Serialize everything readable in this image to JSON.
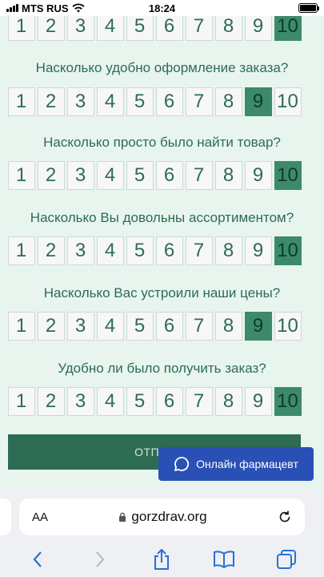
{
  "status_bar": {
    "carrier": "MTS RUS",
    "time": "18:24"
  },
  "scale_values": [
    "1",
    "2",
    "3",
    "4",
    "5",
    "6",
    "7",
    "8",
    "9",
    "10"
  ],
  "questions": [
    {
      "text": "",
      "selected": 10
    },
    {
      "text": "Насколько удобно оформление заказа?",
      "selected": 9
    },
    {
      "text": "Насколько просто было найти товар?",
      "selected": 10
    },
    {
      "text": "Насколько Вы довольны ассортиментом?",
      "selected": 10
    },
    {
      "text": "Насколько Вас устроили наши цены?",
      "selected": 9
    },
    {
      "text": "Удобно ли было получить заказ?",
      "selected": 10
    }
  ],
  "submit_label": "ОТПРА",
  "chat_button_label": "Онлайн фармацевт",
  "browser": {
    "aa_label": "AA",
    "url": "gorzdrav.org"
  },
  "colors": {
    "accent": "#3d8a6b",
    "button": "#2e6b55",
    "chat": "#2950b5",
    "background": "#e8f5ef"
  }
}
